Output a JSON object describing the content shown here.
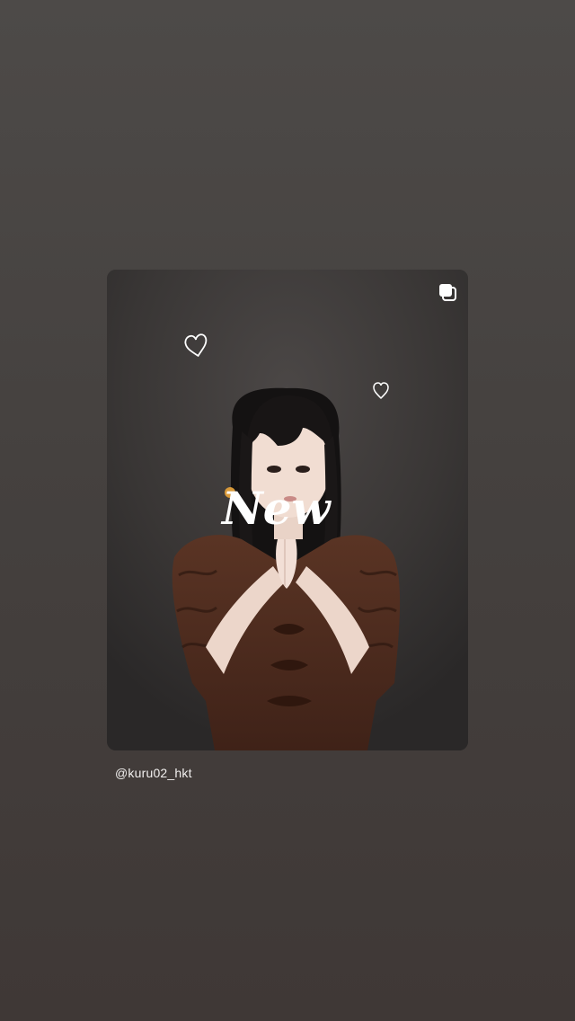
{
  "story": {
    "post": {
      "username": "@kuru02_hkt",
      "sticker_text": "New",
      "multi_image_icon": "multiple-images-icon",
      "hearts": [
        "heart-doodle-icon",
        "heart-doodle-icon"
      ]
    }
  }
}
